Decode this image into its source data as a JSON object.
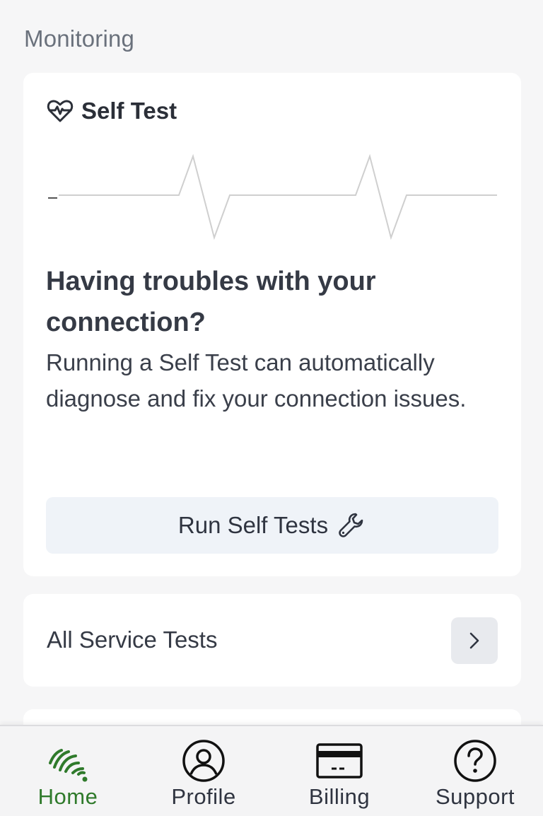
{
  "section": {
    "title": "Monitoring"
  },
  "self_test": {
    "title": "Self Test",
    "icon": "heart-pulse-icon",
    "headline": "Having troubles with your connection?",
    "description": "Running a Self Test can automatically diagnose and fix your connection issues.",
    "button_label": "Run Self Tests",
    "button_icon": "wrench-icon"
  },
  "service_tests": {
    "label": "All Service Tests",
    "icon": "chevron-right-icon"
  },
  "tabbar": {
    "active_color": "#2f7a2b",
    "tabs": [
      {
        "label": "Home",
        "icon": "wifi-logo-icon",
        "active": true
      },
      {
        "label": "Profile",
        "icon": "profile-icon",
        "active": false
      },
      {
        "label": "Billing",
        "icon": "credit-card-icon",
        "active": false
      },
      {
        "label": "Support",
        "icon": "question-circle-icon",
        "active": false
      }
    ]
  }
}
